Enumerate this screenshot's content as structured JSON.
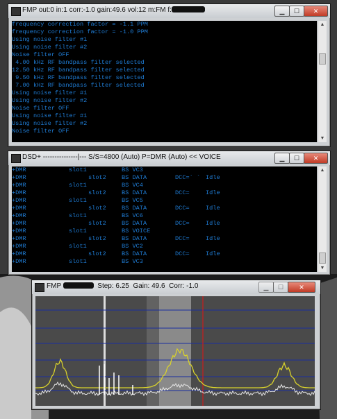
{
  "console1": {
    "title_prefix": "FMP  out:0 in:1 corr:-1.0 gain:49.6 vol:12 m:FM f:",
    "lines": [
      "frequency correction factor = -1.1 PPM",
      "frequency correction factor = -1.0 PPM",
      "Using noise filter #1",
      "Using noise filter #2",
      "Noise filter OFF",
      " 4.00 kHz RF bandpass filter selected",
      "12.50 kHz RF bandpass filter selected",
      " 9.50 kHz RF bandpass filter selected",
      " 7.00 kHz RF bandpass filter selected",
      "Using noise filter #1",
      "Using noise filter #2",
      "Noise filter OFF",
      "Using noise filter #1",
      "Using noise filter #2",
      "Noise filter OFF"
    ]
  },
  "console2": {
    "title": "DSD+    ---------------|---  S/S=4800 (Auto) P=DMR (Auto)    << VOICE",
    "rows": [
      {
        "proto": "+DMR",
        "slot1": "slot1",
        "slot2": "",
        "type": "BS VC3",
        "dcc": "",
        "status": ""
      },
      {
        "proto": "+DMR",
        "slot1": "",
        "slot2": "slot2",
        "type": "BS DATA",
        "dcc": "DCC=` `",
        "status": "Idle"
      },
      {
        "proto": "+DMR",
        "slot1": "slot1",
        "slot2": "",
        "type": "BS VC4",
        "dcc": "",
        "status": ""
      },
      {
        "proto": "+DMR",
        "slot1": "",
        "slot2": "slot2",
        "type": "BS DATA",
        "dcc": "DCC=",
        "status": "Idle"
      },
      {
        "proto": "+DMR",
        "slot1": "slot1",
        "slot2": "",
        "type": "BS VC5",
        "dcc": "",
        "status": ""
      },
      {
        "proto": "+DMR",
        "slot1": "",
        "slot2": "slot2",
        "type": "BS DATA",
        "dcc": "DCC=",
        "status": "Idle"
      },
      {
        "proto": "+DMR",
        "slot1": "slot1",
        "slot2": "",
        "type": "BS VC6",
        "dcc": "",
        "status": ""
      },
      {
        "proto": "+DMR",
        "slot1": "",
        "slot2": "slot2",
        "type": "BS DATA",
        "dcc": "DCC=",
        "status": "Idle"
      },
      {
        "proto": "+DMR",
        "slot1": "slot1",
        "slot2": "",
        "type": "BS VOICE",
        "dcc": "",
        "status": ""
      },
      {
        "proto": "+DMR",
        "slot1": "",
        "slot2": "slot2",
        "type": "BS DATA",
        "dcc": "DCC=",
        "status": "Idle"
      },
      {
        "proto": "+DMR",
        "slot1": "slot1",
        "slot2": "",
        "type": "BS VC2",
        "dcc": "",
        "status": ""
      },
      {
        "proto": "+DMR",
        "slot1": "",
        "slot2": "slot2",
        "type": "BS DATA",
        "dcc": "DCC=",
        "status": "Idle"
      },
      {
        "proto": "+DMR",
        "slot1": "slot1",
        "slot2": "",
        "type": "BS VC3",
        "dcc": "",
        "status": ""
      }
    ]
  },
  "spectrum_window": {
    "title_prefix": "FMP",
    "step_label": "Step: 6.25",
    "gain_label": "Gain: 49.6",
    "corr_label": "Corr: -1.0"
  },
  "controls": {
    "minimize": "▁",
    "maximize": "☐",
    "close": "✕"
  },
  "colors": {
    "console_text": "#1f7cd4",
    "trace_peak": "#d8d22c",
    "trace_live": "#e6e6e6",
    "gridline": "#1a2fa0",
    "tuned_marker": "#cc1d1d",
    "window_close": "#c13b26"
  },
  "icons": [
    "window-app-icon",
    "minimize-icon",
    "maximize-icon",
    "close-icon",
    "scroll-up-icon",
    "scroll-down-icon"
  ]
}
